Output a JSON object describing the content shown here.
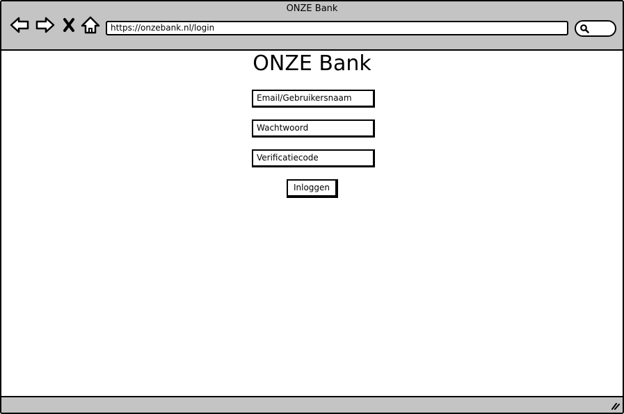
{
  "window": {
    "title": "ONZE Bank"
  },
  "toolbar": {
    "icons": [
      "back-arrow-icon",
      "forward-arrow-icon",
      "close-x-icon",
      "home-icon",
      "search-icon"
    ],
    "url": "https://onzebank.nl/login"
  },
  "page": {
    "heading": "ONZE Bank",
    "fields": {
      "email_placeholder": "Email/Gebruikersnaam",
      "password_placeholder": "Wachtwoord",
      "code_placeholder": "Verificatiecode"
    },
    "login_label": "Inloggen"
  },
  "colors": {
    "chrome": "#c4c4c4",
    "outline": "#000000",
    "background": "#ffffff"
  }
}
